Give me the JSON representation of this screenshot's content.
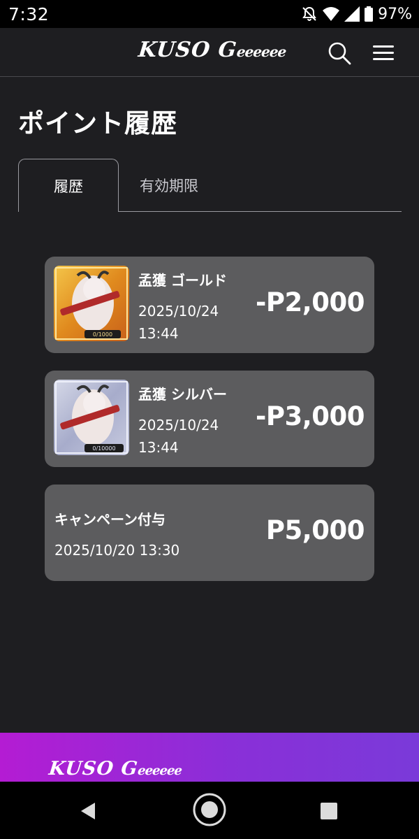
{
  "status_bar": {
    "time": "7:32",
    "battery_percent": "97%",
    "icons": [
      "bell-off-icon",
      "wifi-icon",
      "signal-icon",
      "battery-icon"
    ]
  },
  "header": {
    "logo_main": "KUSO G",
    "logo_tail": "eeeeee",
    "search_icon": "search-icon",
    "menu_icon": "hamburger-menu-icon"
  },
  "page": {
    "title": "ポイント履歴"
  },
  "tabs": [
    {
      "label": "履歴",
      "active": true
    },
    {
      "label": "有効期限",
      "active": false
    }
  ],
  "history": [
    {
      "title": "孟獲 ゴールド",
      "date": "2025/10/24",
      "time": "13:44",
      "amount": "-P2,000",
      "thumb_counter": "0/1000",
      "thumb_frame_color": "#d9a224"
    },
    {
      "title": "孟獲 シルバー",
      "date": "2025/10/24",
      "time": "13:44",
      "amount": "-P3,000",
      "thumb_counter": "0/10000",
      "thumb_frame_color": "#b8bccd"
    },
    {
      "title": "キャンペーン付与",
      "datetime": "2025/10/20 13:30",
      "amount": "P5,000"
    }
  ],
  "footer": {
    "logo_main": "KUSO G",
    "logo_tail": "eeeeee",
    "gradient_from": "#b41cd3",
    "gradient_to": "#7a3ad9"
  },
  "nav_bar": {
    "icons": [
      "back-icon",
      "home-icon",
      "recents-icon"
    ]
  }
}
